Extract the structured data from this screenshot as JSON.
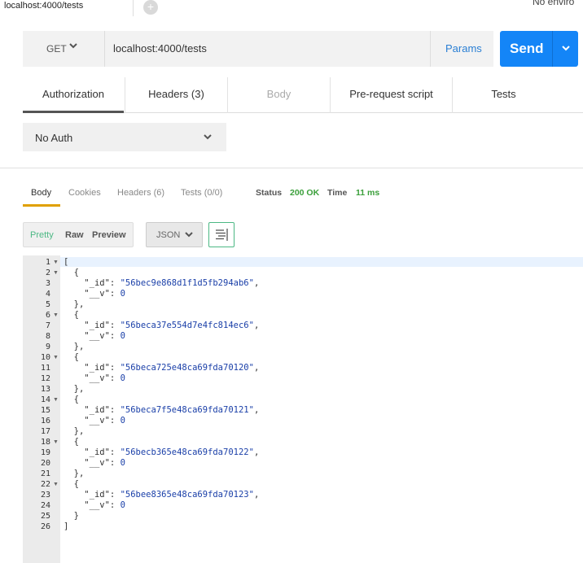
{
  "tab": {
    "title": "localhost:4000/tests",
    "add_icon": "plus-circle-icon"
  },
  "environment": {
    "label": "No enviro"
  },
  "request": {
    "method": "GET",
    "url": "localhost:4000/tests",
    "params_label": "Params",
    "send_label": "Send"
  },
  "request_tabs": [
    {
      "label": "Authorization",
      "active": true
    },
    {
      "label": "Headers (3)"
    },
    {
      "label": "Body",
      "disabled": true
    },
    {
      "label": "Pre-request script"
    },
    {
      "label": "Tests"
    }
  ],
  "auth": {
    "selected": "No Auth"
  },
  "response": {
    "tabs": [
      {
        "label": "Body",
        "active": true
      },
      {
        "label": "Cookies"
      },
      {
        "label": "Headers (6)"
      },
      {
        "label": "Tests (0/0)"
      }
    ],
    "status_label": "Status",
    "status_value": "200 OK",
    "time_label": "Time",
    "time_value": "11 ms",
    "formats": [
      "Pretty",
      "Raw",
      "Preview"
    ],
    "active_format": "Pretty",
    "language": "JSON",
    "body_lines": [
      "[",
      "  {",
      "    \"_id\": \"56bec9e868d1f1d5fb294ab6\",",
      "    \"__v\": 0",
      "  },",
      "  {",
      "    \"_id\": \"56beca37e554d7e4fc814ec6\",",
      "    \"__v\": 0",
      "  },",
      "  {",
      "    \"_id\": \"56beca725e48ca69fda70120\",",
      "    \"__v\": 0",
      "  },",
      "  {",
      "    \"_id\": \"56beca7f5e48ca69fda70121\",",
      "    \"__v\": 0",
      "  },",
      "  {",
      "    \"_id\": \"56becb365e48ca69fda70122\",",
      "    \"__v\": 0",
      "  },",
      "  {",
      "    \"_id\": \"56bee8365e48ca69fda70123\",",
      "    \"__v\": 0",
      "  }",
      "]"
    ],
    "foldable_lines": [
      1,
      2,
      6,
      10,
      14,
      18,
      22
    ]
  },
  "colors": {
    "send": "#1485f7",
    "status_ok": "#3a9f3a",
    "pretty_active": "#4cb884",
    "body_tab_underline": "#e0a000"
  }
}
